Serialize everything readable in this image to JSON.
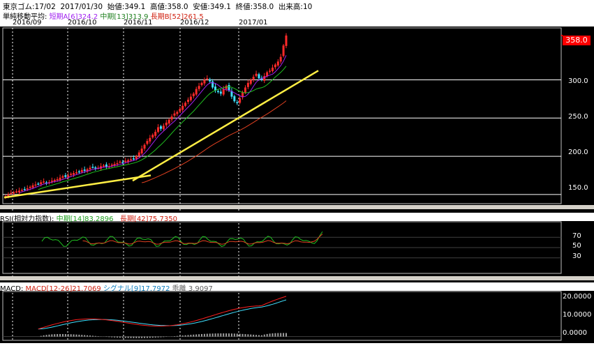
{
  "header": {
    "instrument": "東京ゴム:17/02",
    "date": "2017/01/30",
    "open_label": "始値:",
    "open": "349.1",
    "high_label": "高値:",
    "high": "358.0",
    "low_label": "安値:",
    "low": "349.1",
    "close_label": "終値:",
    "close": "358.0",
    "volume_label": "出来高:",
    "volume": "10",
    "ma_title": "単純移動平均:",
    "ma_short": "短期A[6]324.2",
    "ma_mid": "中期[13]313.9",
    "ma_long": "長期B[52]261.5",
    "months": [
      "2016/09",
      "2016/10",
      "2016/11",
      "2016/12",
      "2017/01"
    ]
  },
  "price_panel": {
    "current_price": "358.0",
    "y_ticks": [
      "300.0",
      "250.0",
      "200.0",
      "150.0"
    ],
    "colors": {
      "up": "#ff2a2a",
      "down": "#40e0ff",
      "short_ma": "#a020f0",
      "mid_ma": "#20c020",
      "long_ma": "#e04020",
      "trend": "#ffee44"
    }
  },
  "rsi_panel": {
    "title": "RSI(相対力指数):",
    "mid": "中期[14]83.2896",
    "long": "長期[42]75.7350",
    "y_ticks": [
      "70",
      "50",
      "30"
    ]
  },
  "macd_panel": {
    "title": "MACD:",
    "macd": "MACD[12-26]21.7069",
    "signal": "シグナル[9]17.7972",
    "divergence": "乖離 3.9097",
    "y_ticks": [
      "20.0000",
      "10.0000",
      "0.0000"
    ]
  },
  "chart_data": [
    {
      "type": "candlestick",
      "title": "東京ゴム:17/02",
      "x": [
        "2016/09",
        "2016/10",
        "2016/11",
        "2016/12",
        "2017/01"
      ],
      "ylim": [
        138,
        368
      ],
      "y_ticks": [
        150,
        200,
        250,
        300
      ],
      "close": [
        148,
        150,
        152,
        153,
        154,
        155,
        156,
        157,
        158,
        160,
        162,
        163,
        164,
        166,
        167,
        165,
        166,
        168,
        169,
        170,
        172,
        174,
        173,
        175,
        177,
        178,
        179,
        180,
        182,
        181,
        183,
        185,
        186,
        184,
        185,
        187,
        188,
        186,
        187,
        189,
        190,
        191,
        193,
        192,
        194,
        195,
        196,
        197,
        200,
        205,
        210,
        215,
        220,
        224,
        228,
        232,
        238,
        236,
        240,
        244,
        248,
        252,
        256,
        258,
        262,
        266,
        270,
        274,
        278,
        282,
        288,
        292,
        296,
        300,
        302,
        298,
        290,
        286,
        284,
        282,
        288,
        292,
        286,
        278,
        272,
        270,
        276,
        284,
        290,
        296,
        300,
        304,
        308,
        302,
        300,
        305,
        310,
        312,
        316,
        320,
        324,
        330,
        345,
        358
      ],
      "ma_short_last": 324.2,
      "ma_mid_last": 313.9,
      "ma_long_last": 261.5
    },
    {
      "type": "line",
      "title": "RSI(相対力指数):",
      "ylim": [
        0,
        100
      ],
      "y_ticks": [
        70,
        50,
        30
      ],
      "series": [
        {
          "name": "中期[14]",
          "last": 83.2896
        },
        {
          "name": "長期[42]",
          "last": 75.735
        }
      ]
    },
    {
      "type": "line",
      "title": "MACD:",
      "ylim": [
        -2,
        24
      ],
      "y_ticks": [
        20,
        10,
        0
      ],
      "series": [
        {
          "name": "MACD[12-26]",
          "last": 21.7069
        },
        {
          "name": "シグナル[9]",
          "last": 17.7972
        },
        {
          "name": "乖離",
          "last": 3.9097
        }
      ]
    }
  ]
}
